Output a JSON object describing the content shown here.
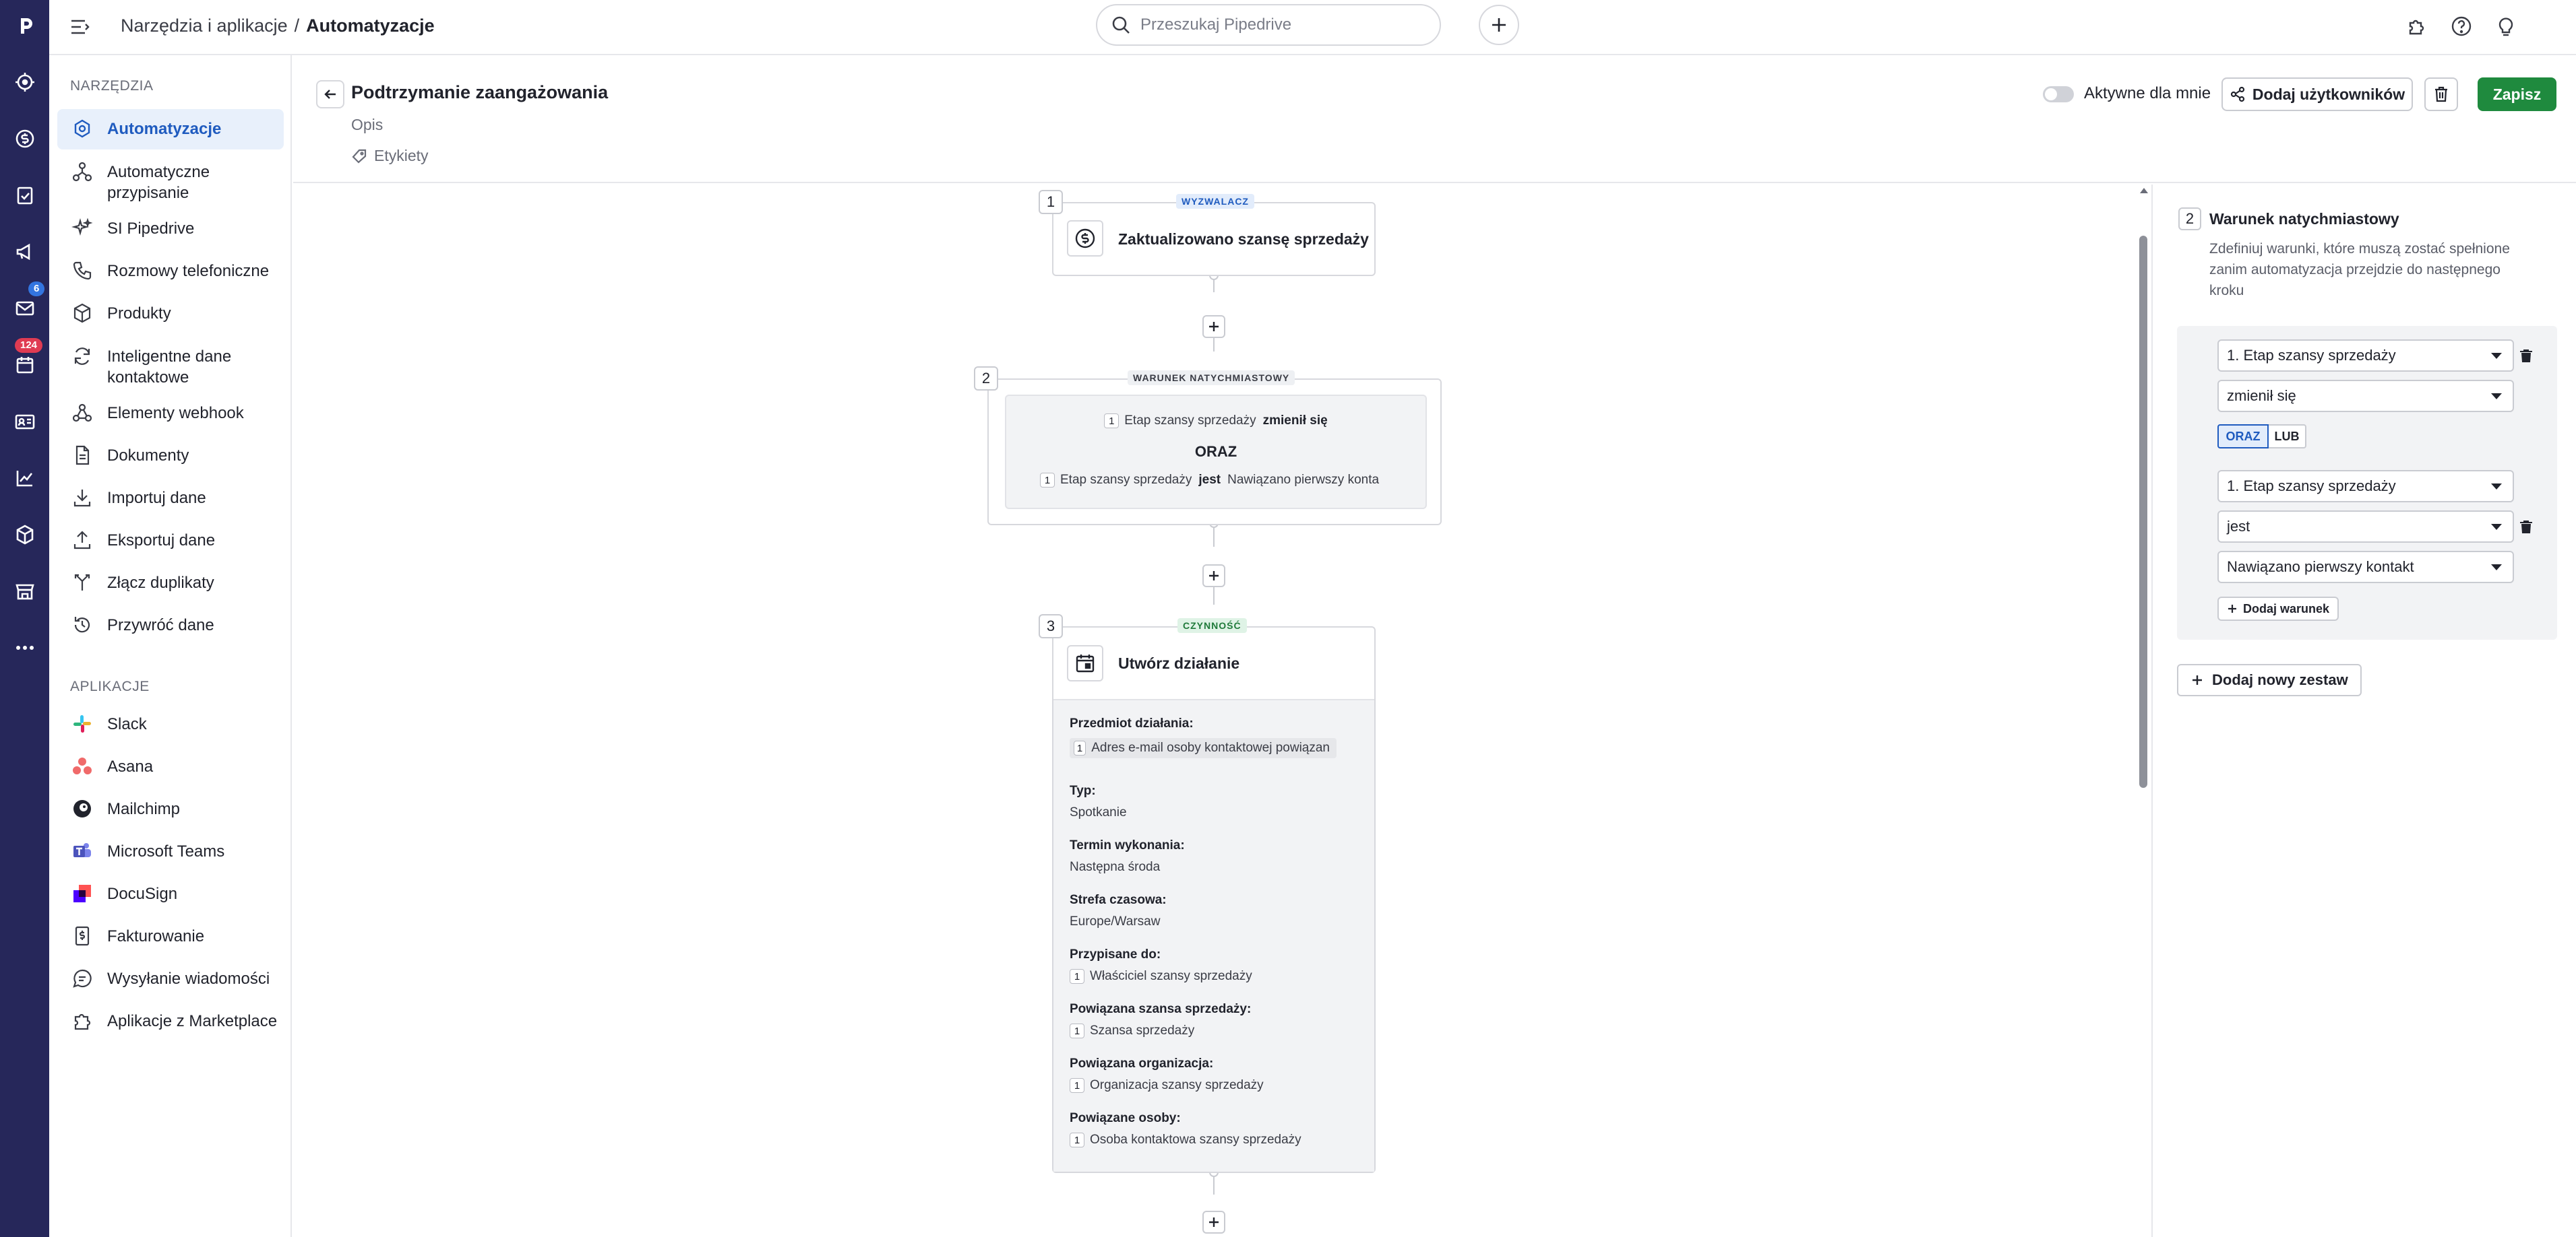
{
  "breadcrumb": {
    "parent": "Narzędzia i aplikacje",
    "separator": "/",
    "current": "Automatyzacje"
  },
  "search": {
    "placeholder": "Przeszukaj Pipedrive"
  },
  "rail": {
    "badges": {
      "mail": "6",
      "activities": "124"
    }
  },
  "sidenav": {
    "tools_title": "NARZĘDZIA",
    "tools": [
      {
        "label": "Automatyzacje",
        "icon": "automation-icon"
      },
      {
        "label": "Automatyczne przypisanie",
        "icon": "assignment-icon"
      },
      {
        "label": "SI Pipedrive",
        "icon": "sparkle-icon"
      },
      {
        "label": "Rozmowy telefoniczne",
        "icon": "phone-icon"
      },
      {
        "label": "Produkty",
        "icon": "box-icon"
      },
      {
        "label": "Inteligentne dane kontaktowe",
        "icon": "sync-icon"
      },
      {
        "label": "Elementy webhook",
        "icon": "webhook-icon"
      },
      {
        "label": "Dokumenty",
        "icon": "document-icon"
      },
      {
        "label": "Importuj dane",
        "icon": "import-icon"
      },
      {
        "label": "Eksportuj dane",
        "icon": "export-icon"
      },
      {
        "label": "Złącz duplikaty",
        "icon": "merge-icon"
      },
      {
        "label": "Przywróć dane",
        "icon": "restore-icon"
      }
    ],
    "apps_title": "APLIKACJE",
    "apps": [
      {
        "label": "Slack",
        "icon": "slack-icon"
      },
      {
        "label": "Asana",
        "icon": "asana-icon"
      },
      {
        "label": "Mailchimp",
        "icon": "mailchimp-icon"
      },
      {
        "label": "Microsoft Teams",
        "icon": "teams-icon"
      },
      {
        "label": "DocuSign",
        "icon": "docusign-icon"
      },
      {
        "label": "Fakturowanie",
        "icon": "invoice-icon"
      },
      {
        "label": "Wysyłanie wiadomości",
        "icon": "message-icon"
      },
      {
        "label": "Aplikacje z Marketplace",
        "icon": "puzzle-icon"
      }
    ]
  },
  "header": {
    "title": "Podtrzymanie zaangażowania",
    "description": "Opis",
    "tags": "Etykiety",
    "active_for_me": "Aktywne dla mnie",
    "add_users": "Dodaj użytkowników",
    "save": "Zapisz"
  },
  "flow": {
    "step1": {
      "num": "1",
      "tag": "WYZWALACZ",
      "title": "Zaktualizowano szansę sprzedaży"
    },
    "step2": {
      "num": "2",
      "tag": "WARUNEK NATYCHMIASTOWY",
      "line1": {
        "chip": "1",
        "field": "Etap szansy sprzedaży",
        "op": "zmienił się"
      },
      "joiner": "ORAZ",
      "line2": {
        "chip": "1",
        "field": "Etap szansy sprzedaży",
        "op": "jest",
        "value": "Nawiązano pierwszy konta"
      }
    },
    "step3": {
      "num": "3",
      "tag": "CZYNNOŚĆ",
      "title": "Utwórz działanie",
      "fields": [
        {
          "label": "Przedmiot działania:",
          "chip": "1",
          "value": "Adres e-mail osoby kontaktowej powiązan"
        },
        {
          "label": "Typ:",
          "chip": "",
          "value": "Spotkanie"
        },
        {
          "label": "Termin wykonania:",
          "chip": "",
          "value": "Następna środa"
        },
        {
          "label": "Strefa czasowa:",
          "chip": "",
          "value": "Europe/Warsaw"
        },
        {
          "label": "Przypisane do:",
          "chip": "1",
          "value": "Właściciel szansy sprzedaży"
        },
        {
          "label": "Powiązana szansa sprzedaży:",
          "chip": "1",
          "value": "Szansa sprzedaży"
        },
        {
          "label": "Powiązana organizacja:",
          "chip": "1",
          "value": "Organizacja szansy sprzedaży"
        },
        {
          "label": "Powiązane osoby:",
          "chip": "1",
          "value": "Osoba kontaktowa szansy sprzedaży"
        }
      ]
    }
  },
  "panel": {
    "num": "2",
    "title": "Warunek natychmiastowy",
    "desc": "Zdefiniuj warunki, które muszą zostać spełnione zanim automatyzacja przejdzie do następnego kroku",
    "group1": {
      "field": "1. Etap szansy sprzedaży",
      "operator": "zmienił się"
    },
    "and": "ORAZ",
    "or": "LUB",
    "group2": {
      "field": "1. Etap szansy sprzedaży",
      "operator": "jest",
      "value": "Nawiązano pierwszy kontakt"
    },
    "add_condition": "Dodaj warunek",
    "add_set": "Dodaj nowy zestaw"
  },
  "colors": {
    "rail": "#26275a",
    "accent": "#1f5bbf",
    "save": "#1f8a3e",
    "badge": "#e03b52"
  }
}
